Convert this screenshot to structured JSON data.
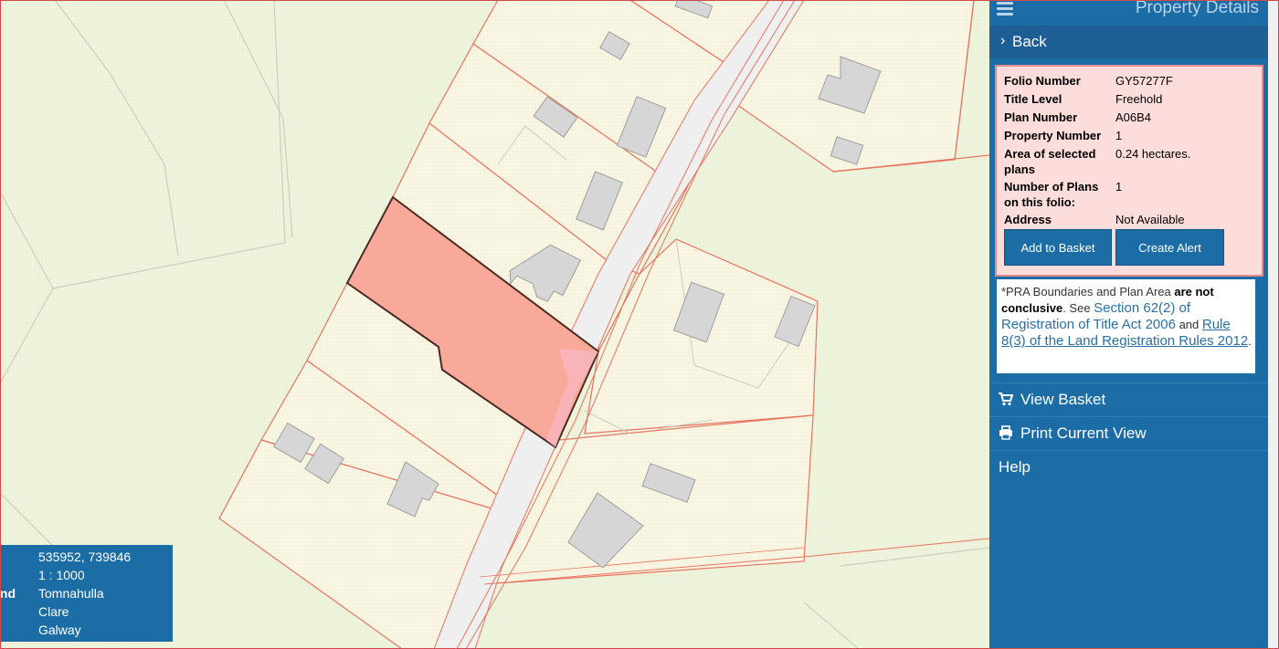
{
  "sidebar": {
    "title": "Property Details",
    "back_label": "Back",
    "details": [
      {
        "label": "Folio Number",
        "value": "GY57277F"
      },
      {
        "label": "Title Level",
        "value": "Freehold"
      },
      {
        "label": "Plan Number",
        "value": "A06B4"
      },
      {
        "label": "Property Number",
        "value": "1"
      },
      {
        "label": "Area of selected plans",
        "value": "0.24 hectares."
      },
      {
        "label": "Number of Plans on this folio:",
        "value": "1"
      },
      {
        "label": "Address",
        "value": "Not Available"
      }
    ],
    "add_to_basket_label": "Add to Basket",
    "create_alert_label": "Create Alert",
    "notice": {
      "prefix": "*PRA Boundaries and Plan Area ",
      "bold": "are not conclusive",
      "see": ". See ",
      "link1": "Section 62(2) of Registration of Title Act 2006",
      "and": " and ",
      "link2a": "Rule 8(3) of",
      "link2b": " the Land Registration Rules 2012",
      "end": "."
    },
    "menu": [
      {
        "label": "View Basket",
        "icon": "cart-icon"
      },
      {
        "label": "Print Current View",
        "icon": "print-icon"
      },
      {
        "label": "Help",
        "icon": ""
      }
    ]
  },
  "coords": {
    "rows": [
      {
        "label": "",
        "value": "535952, 739846"
      },
      {
        "label": "",
        "value": "1 : 1000"
      },
      {
        "label": "nd",
        "value": "Tomnahulla"
      },
      {
        "label": "",
        "value": "Clare"
      },
      {
        "label": "",
        "value": "Galway"
      }
    ]
  },
  "colors": {
    "sidebar_bg": "#1c6da6",
    "selected_parcel": "#f9a99a",
    "boundary": "#e8735f",
    "building": "#d6d6d6",
    "map_bg": "#f0f4e0"
  }
}
